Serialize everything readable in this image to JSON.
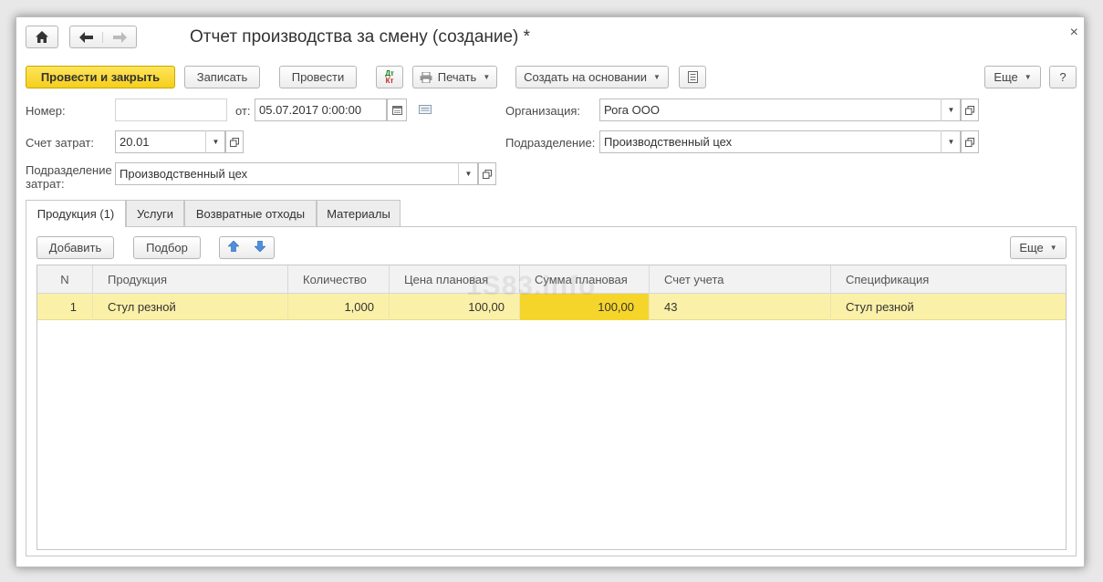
{
  "window": {
    "title": "Отчет производства за смену (создание) *",
    "close": "×"
  },
  "toolbar": {
    "post_and_close": "Провести и закрыть",
    "save": "Записать",
    "post": "Провести",
    "dt_kt_top": "Дт",
    "dt_kt_bottom": "Кт",
    "print": "Печать",
    "create_based": "Создать на основании",
    "more": "Еще",
    "help": "?"
  },
  "form": {
    "number_label": "Номер:",
    "number_value": "",
    "date_label": "от:",
    "date_value": "05.07.2017  0:00:00",
    "org_label": "Организация:",
    "org_value": "Рога ООО",
    "cost_account_label": "Счет затрат:",
    "cost_account_value": "20.01",
    "division_label": "Подразделение:",
    "division_value": "Производственный цех",
    "cost_division_label_1": "Подразделение",
    "cost_division_label_2": "затрат:",
    "cost_division_value": "Производственный цех"
  },
  "tabs": [
    {
      "label": "Продукция (1)"
    },
    {
      "label": "Услуги"
    },
    {
      "label": "Возвратные отходы"
    },
    {
      "label": "Материалы"
    }
  ],
  "table_toolbar": {
    "add": "Добавить",
    "pick": "Подбор",
    "more": "Еще"
  },
  "table": {
    "watermark": "1S83.info",
    "columns": [
      "N",
      "Продукция",
      "Количество",
      "Цена плановая",
      "Сумма плановая",
      "Счет учета",
      "Спецификация"
    ],
    "rows": [
      {
        "n": "1",
        "product": "Стул резной",
        "qty": "1,000",
        "price": "100,00",
        "sum": "100,00",
        "account": "43",
        "spec": "Стул резной"
      }
    ]
  }
}
